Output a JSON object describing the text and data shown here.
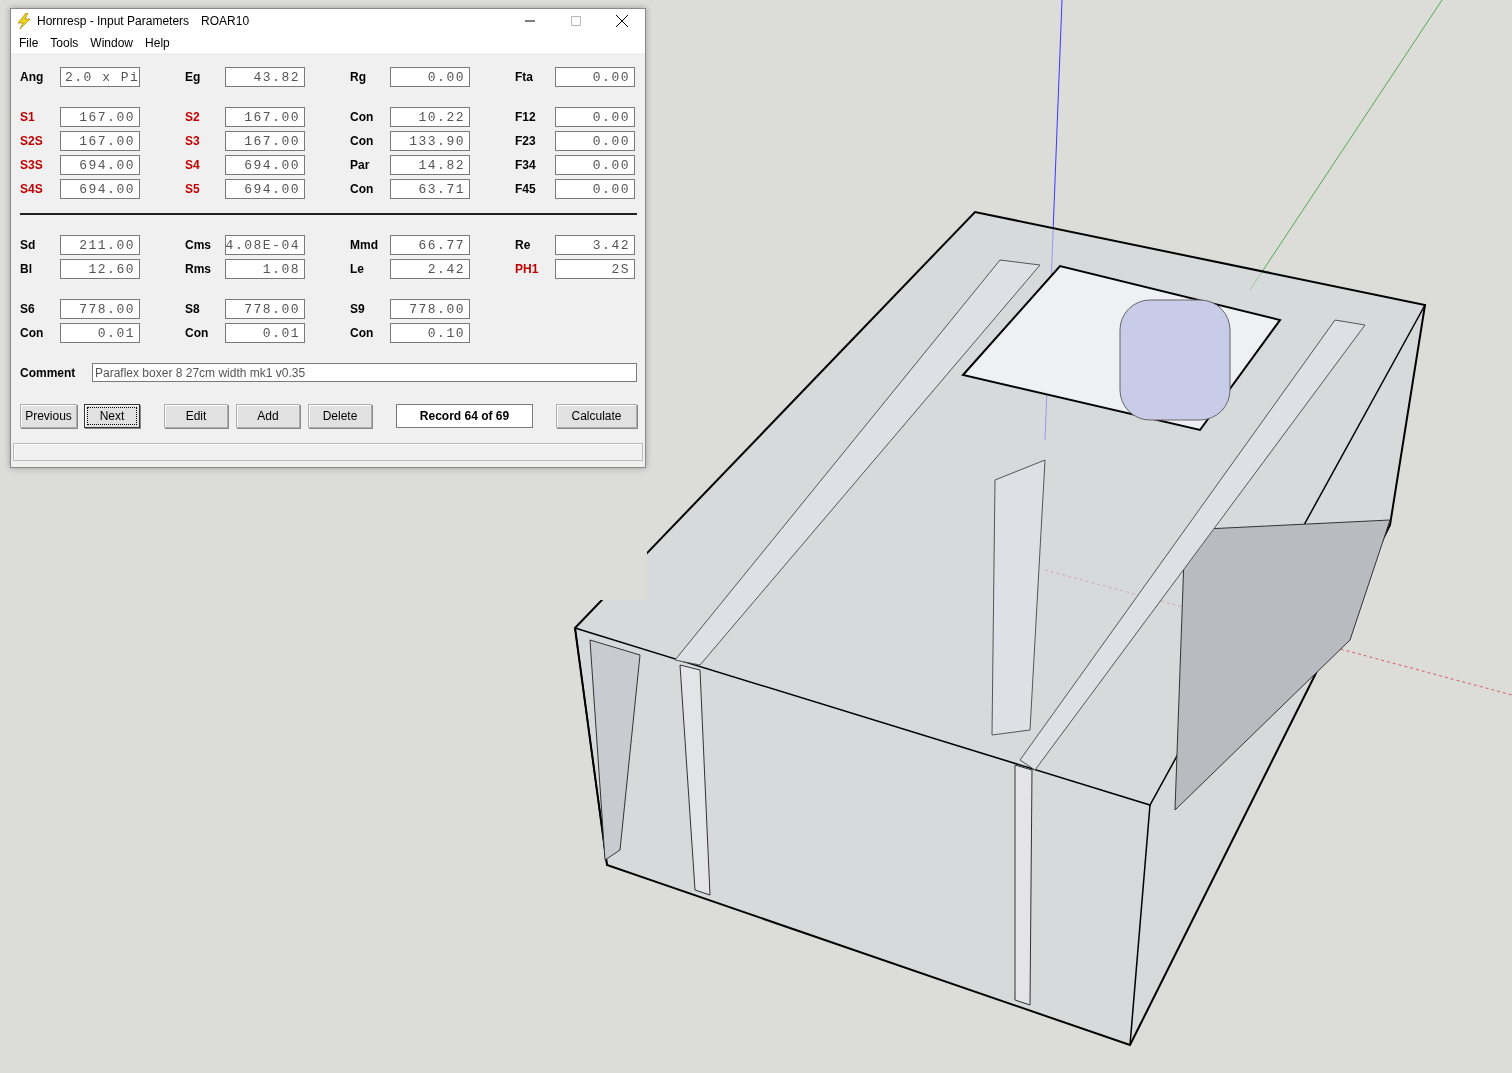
{
  "window": {
    "title": "Hornresp - Input Parameters",
    "record_name": "ROAR10"
  },
  "menu": [
    "File",
    "Tools",
    "Window",
    "Help"
  ],
  "sections": [
    {
      "rows": [
        [
          {
            "label": "Ang",
            "value": "2.0 x Pi",
            "color": "#000000"
          },
          {
            "label": "Eg",
            "value": "43.82",
            "color": "#000000"
          },
          {
            "label": "Rg",
            "value": "0.00",
            "color": "#000000"
          },
          {
            "label": "Fta",
            "value": "0.00",
            "color": "#000000"
          }
        ]
      ]
    },
    {
      "rows": [
        [
          {
            "label": "S1",
            "value": "167.00",
            "color": "#c00000"
          },
          {
            "label": "S2",
            "value": "167.00",
            "color": "#c00000"
          },
          {
            "label": "Con",
            "value": "10.22",
            "color": "#000000"
          },
          {
            "label": "F12",
            "value": "0.00",
            "color": "#000000"
          }
        ],
        [
          {
            "label": "S2S",
            "value": "167.00",
            "color": "#c00000"
          },
          {
            "label": "S3",
            "value": "167.00",
            "color": "#c00000"
          },
          {
            "label": "Con",
            "value": "133.90",
            "color": "#000000"
          },
          {
            "label": "F23",
            "value": "0.00",
            "color": "#000000"
          }
        ],
        [
          {
            "label": "S3S",
            "value": "694.00",
            "color": "#c00000"
          },
          {
            "label": "S4",
            "value": "694.00",
            "color": "#c00000"
          },
          {
            "label": "Par",
            "value": "14.82",
            "color": "#000000"
          },
          {
            "label": "F34",
            "value": "0.00",
            "color": "#000000"
          }
        ],
        [
          {
            "label": "S4S",
            "value": "694.00",
            "color": "#c00000"
          },
          {
            "label": "S5",
            "value": "694.00",
            "color": "#c00000"
          },
          {
            "label": "Con",
            "value": "63.71",
            "color": "#000000"
          },
          {
            "label": "F45",
            "value": "0.00",
            "color": "#000000"
          }
        ]
      ]
    },
    {
      "divider": true,
      "rows": [
        [
          {
            "label": "Sd",
            "value": "211.00",
            "color": "#000000"
          },
          {
            "label": "Cms",
            "value": "4.08E-04",
            "color": "#000000"
          },
          {
            "label": "Mmd",
            "value": "66.77",
            "color": "#000000"
          },
          {
            "label": "Re",
            "value": "3.42",
            "color": "#000000"
          }
        ],
        [
          {
            "label": "Bl",
            "value": "12.60",
            "color": "#000000"
          },
          {
            "label": "Rms",
            "value": "1.08",
            "color": "#000000"
          },
          {
            "label": "Le",
            "value": "2.42",
            "color": "#000000"
          },
          {
            "label": "PH1",
            "value": "2S",
            "color": "#c00000"
          }
        ]
      ]
    },
    {
      "rows": [
        [
          {
            "label": "S6",
            "value": "778.00",
            "color": "#000000"
          },
          {
            "label": "S8",
            "value": "778.00",
            "color": "#000000"
          },
          {
            "label": "S9",
            "value": "778.00",
            "color": "#000000"
          }
        ],
        [
          {
            "label": "Con",
            "value": "0.01",
            "color": "#000000"
          },
          {
            "label": "Con",
            "value": "0.01",
            "color": "#000000"
          },
          {
            "label": "Con",
            "value": "0.10",
            "color": "#000000"
          }
        ]
      ]
    }
  ],
  "comment": {
    "label": "Comment",
    "value": "Paraflex boxer 8 27cm width mk1 v0.35"
  },
  "buttons": [
    {
      "label": "Previous",
      "selected": false
    },
    {
      "label": "Next",
      "selected": true
    },
    {
      "label": "Edit",
      "selected": false
    },
    {
      "label": "Add",
      "selected": false
    },
    {
      "label": "Delete",
      "selected": false
    }
  ],
  "record": "Record 64 of 69",
  "calculate": "Calculate"
}
